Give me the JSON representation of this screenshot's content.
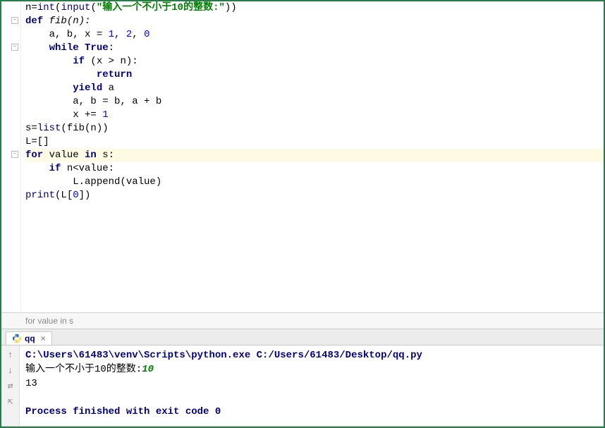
{
  "code": {
    "l1": {
      "a": "n=",
      "b": "int",
      "c": "(",
      "d": "input",
      "e": "(",
      "f": "\"输入一个不小于10的整数:\"",
      "g": "))"
    },
    "l2": {
      "a": "def",
      "b": " fib(n):"
    },
    "l3": {
      "a": "    a, b, x = ",
      "b": "1",
      "c": ", ",
      "d": "2",
      "e": ", ",
      "f": "0"
    },
    "l4": {
      "a": "    ",
      "b": "while True",
      "c": ":"
    },
    "l5": {
      "a": "        ",
      "b": "if",
      "c": " (x > n):"
    },
    "l6": {
      "a": "            ",
      "b": "return"
    },
    "l7": {
      "a": "        ",
      "b": "yield",
      "c": " a"
    },
    "l8": "        a, b = b, a + b",
    "l9": {
      "a": "        x += ",
      "b": "1"
    },
    "l10": {
      "a": "s=",
      "b": "list",
      "c": "(fib(n))"
    },
    "l11": "L=[]",
    "l12": {
      "a": "for",
      "b": " value ",
      "c": "in",
      "d": " s:"
    },
    "l13": {
      "a": "    ",
      "b": "if",
      "c": " n<value:"
    },
    "l14": "        L.append(value)",
    "l15": {
      "a": "print",
      "b": "(L[",
      "c": "0",
      "d": "])"
    }
  },
  "breadcrumb": "for value in s",
  "run_tab": {
    "name": "qq",
    "close": "×"
  },
  "console": {
    "path": "C:\\Users\\61483\\venv\\Scripts\\python.exe C:/Users/61483/Desktop/qq.py",
    "prompt": "输入一个不小于10的整数:",
    "user_input": "10",
    "output": "13",
    "exit": "Process finished with exit code 0"
  },
  "toolbar_icons": {
    "up": "↑",
    "down": "↓",
    "wrap": "⇄",
    "export": "⇱"
  }
}
